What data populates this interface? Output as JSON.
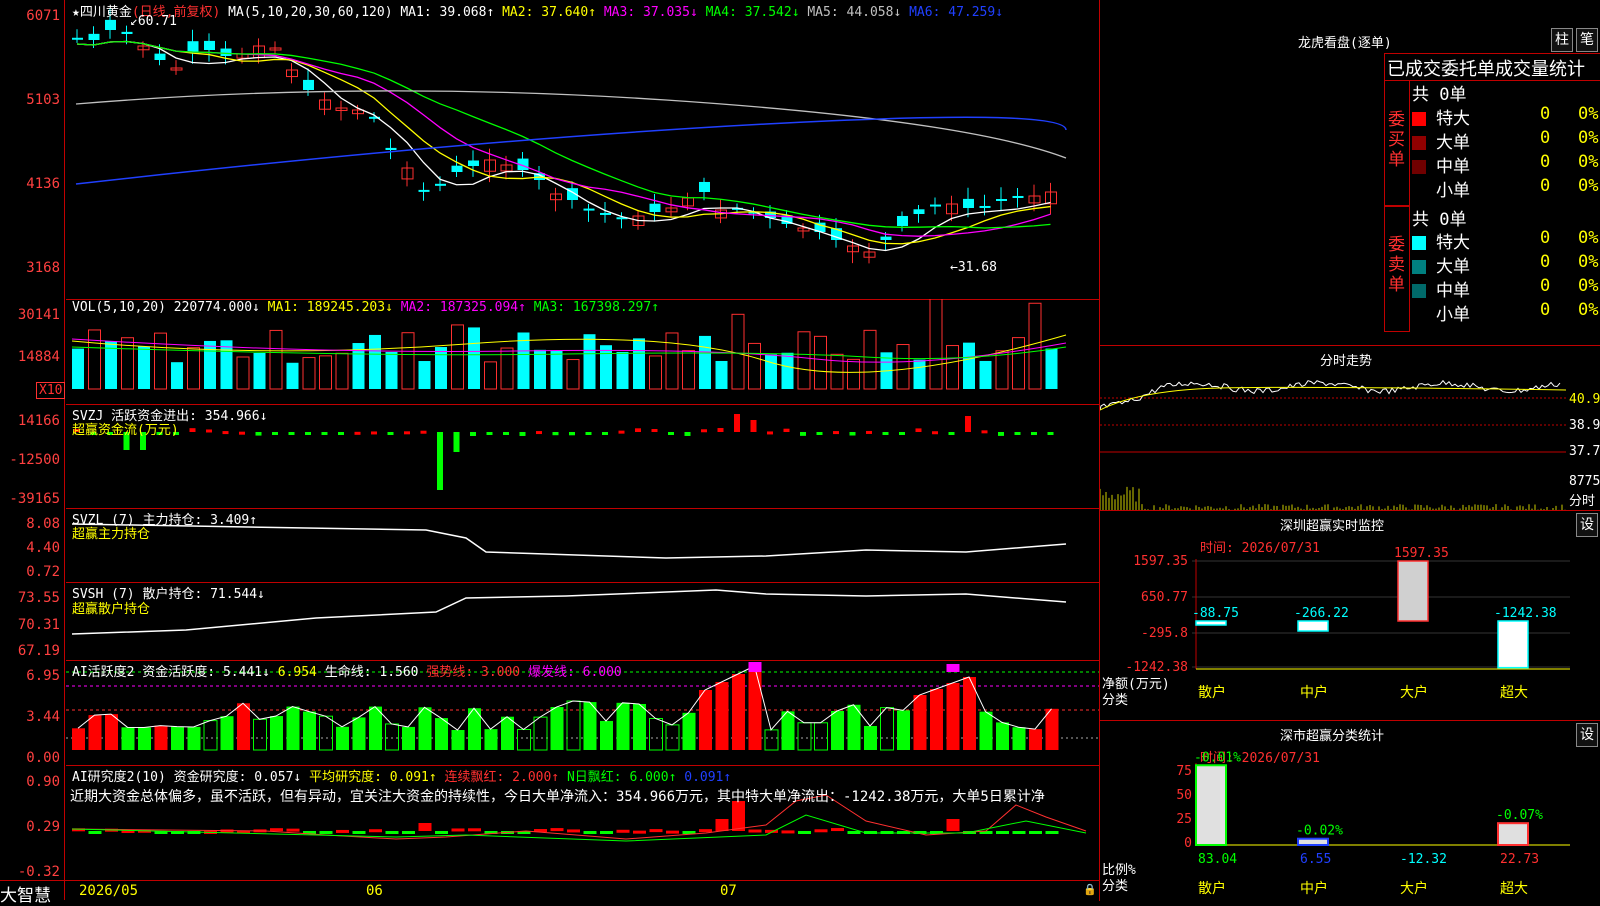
{
  "main": {
    "stock_name": "四川黄金",
    "period": "(日线,前复权)",
    "ma_label": "MA(5,10,20,30,60,120)",
    "ma1": "MA1: 39.068↑",
    "ma2": "MA2: 37.640↑",
    "ma3": "MA3: 37.035↓",
    "ma4": "MA4: 37.542↓",
    "ma5": "MA5: 44.058↓",
    "ma6": "MA6: 47.259↓",
    "high_marker": "60.71",
    "low_marker": "←31.68",
    "y_ticks": [
      "6071",
      "5103",
      "4136",
      "3168"
    ]
  },
  "vol": {
    "header": "VOL(5,10,20)",
    "value": "220774.000↓",
    "ma1": "MA1: 189245.203↓",
    "ma2": "MA2: 187325.094↑",
    "ma3": "MA3: 167398.297↑",
    "y_ticks": [
      "30141",
      "14884"
    ],
    "unit": "X10"
  },
  "svzj": {
    "header": "SVZJ  活跃资金进出: 354.966↓",
    "sub": "超赢资金流(万元)",
    "y_ticks": [
      "14166",
      "-12500",
      "-39165"
    ]
  },
  "svzl": {
    "header": "SVZL (7) 主力持仓: 3.409↑",
    "sub": "超赢主力持仓",
    "y_ticks": [
      "8.08",
      "4.40",
      "0.72"
    ]
  },
  "svsh": {
    "header": "SVSH (7) 散户持仓: 71.544↓",
    "sub": "超赢散户持仓",
    "y_ticks": [
      "73.55",
      "70.31",
      "67.19"
    ]
  },
  "ai1": {
    "header": "AI活跃度2 资金活跃度: 5.441↓",
    "v2": "6.954",
    "life": "生命线: 1.560",
    "strong": "强势线: 3.000",
    "burst": "爆发线: 6.000",
    "y_ticks": [
      "6.95",
      "3.44",
      "0.00"
    ]
  },
  "ai2": {
    "header": "AI研究度2(10) 资金研究度: 0.057↓",
    "avg": "平均研究度: 0.091↑",
    "cont": "连续飘红: 2.000↑",
    "nday": "N日飘红: 6.000↑",
    "v": "0.091↑",
    "note": "近期大资金总体偏多，虽不活跃，但有异动，宜关注大资金的持续性，今日大单净流入：354.966万元，其中特大单净流出：-1242.38万元，大单5日累计净",
    "y_ticks": [
      "0.90",
      "0.29",
      "-0.32"
    ]
  },
  "footer": {
    "logo": "大智慧",
    "d1": "2026/05",
    "d2": "06",
    "d3": "07"
  },
  "lhb": {
    "title": "龙虎看盘(逐单)",
    "btn1": "柱",
    "btn2": "笔",
    "tabs": "已成交委托单成交量统计",
    "buy_label": "委买单",
    "sell_label": "委卖单",
    "buy_total": "共 0单",
    "sell_total": "共 0单",
    "buy_rows": [
      {
        "name": "特大",
        "n": "0",
        "p": "0%",
        "color": "#ff0000"
      },
      {
        "name": "大单",
        "n": "0",
        "p": "0%",
        "color": "#900000"
      },
      {
        "name": "中单",
        "n": "0",
        "p": "0%",
        "color": "#700000"
      },
      {
        "name": "小单",
        "n": "0",
        "p": "0%",
        "color": "#000000"
      }
    ],
    "sell_rows": [
      {
        "name": "特大",
        "n": "0",
        "p": "0%",
        "color": "#00ffff"
      },
      {
        "name": "大单",
        "n": "0",
        "p": "0%",
        "color": "#008080"
      },
      {
        "name": "中单",
        "n": "0",
        "p": "0%",
        "color": "#006a6a"
      },
      {
        "name": "小单",
        "n": "0",
        "p": "0%",
        "color": "#000000"
      }
    ]
  },
  "intraday": {
    "title": "分时走势",
    "y1": "40.9",
    "y2": "38.91",
    "y3": "37.78",
    "y4": "8775",
    "y5": "分时"
  },
  "monitor": {
    "title": "深圳超赢实时监控",
    "btn": "设",
    "time": "时间: 2026/07/31",
    "y_ticks": [
      "1597.35",
      "650.77",
      "-295.8",
      "-1242.38"
    ],
    "unit1": "净额(万元)",
    "unit2": "分类",
    "cats": [
      "散户",
      "中户",
      "大户",
      "超大"
    ],
    "values": [
      "-88.75",
      "-266.22",
      "1597.35",
      "-1242.38"
    ]
  },
  "stats": {
    "title": "深市超赢分类统计",
    "btn": "设",
    "time": "时间: 2026/07/31",
    "y_ticks": [
      "75",
      "50",
      "25",
      "0"
    ],
    "unit1": "比例%",
    "unit2": "分类",
    "cats": [
      "散户",
      "中户",
      "大户",
      "超大"
    ],
    "changes": [
      "-0.01%",
      "-0.02%",
      "",
      "-0.07%"
    ],
    "values": [
      "83.04",
      "6.55",
      "-12.32",
      "22.73"
    ]
  }
}
